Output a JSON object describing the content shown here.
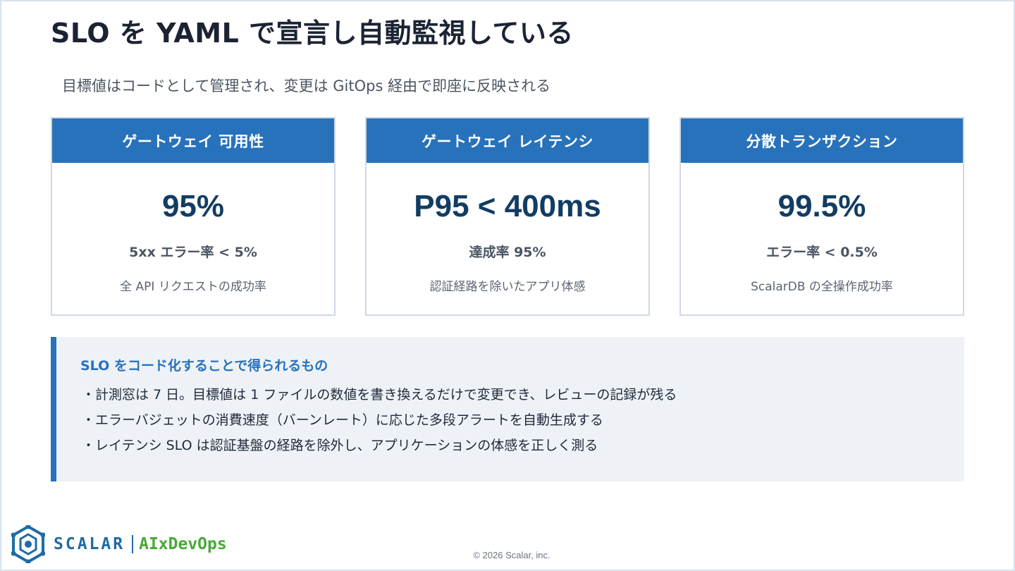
{
  "title": "SLO を YAML で宣言し自動監視している",
  "subtitle": "目標値はコードとして管理され、変更は GitOps 経由で即座に反映される",
  "cards": [
    {
      "header": "ゲートウェイ 可用性",
      "value": "95%",
      "metric": "5xx エラー率 < 5%",
      "description": "全 API リクエストの成功率"
    },
    {
      "header": "ゲートウェイ レイテンシ",
      "value": "P95 < 400ms",
      "metric": "達成率 95%",
      "description": "認証経路を除いたアプリ体感"
    },
    {
      "header": "分散トランザクション",
      "value": "99.5%",
      "metric": "エラー率 < 0.5%",
      "description": "ScalarDB の全操作成功率"
    }
  ],
  "benefits": {
    "title": "SLO をコード化することで得られるもの",
    "items": [
      "・計測窓は 7 日。目標値は 1 ファイルの数値を書き換えるだけで変更でき、レビューの記録が残る",
      "・エラーバジェットの消費速度（バーンレート）に応じた多段アラートを自動生成する",
      "・レイテンシ SLO は認証基盤の経路を除外し、アプリケーションの体感を正しく測る"
    ]
  },
  "footer": {
    "logo_text": "SCALAR",
    "product": "AIxDevOps",
    "copyright": "© 2026 Scalar, inc."
  },
  "colors": {
    "accent": "#2872bb",
    "value_text": "#123d63",
    "panel_bg": "#eef2f7",
    "product_green": "#49a838"
  }
}
